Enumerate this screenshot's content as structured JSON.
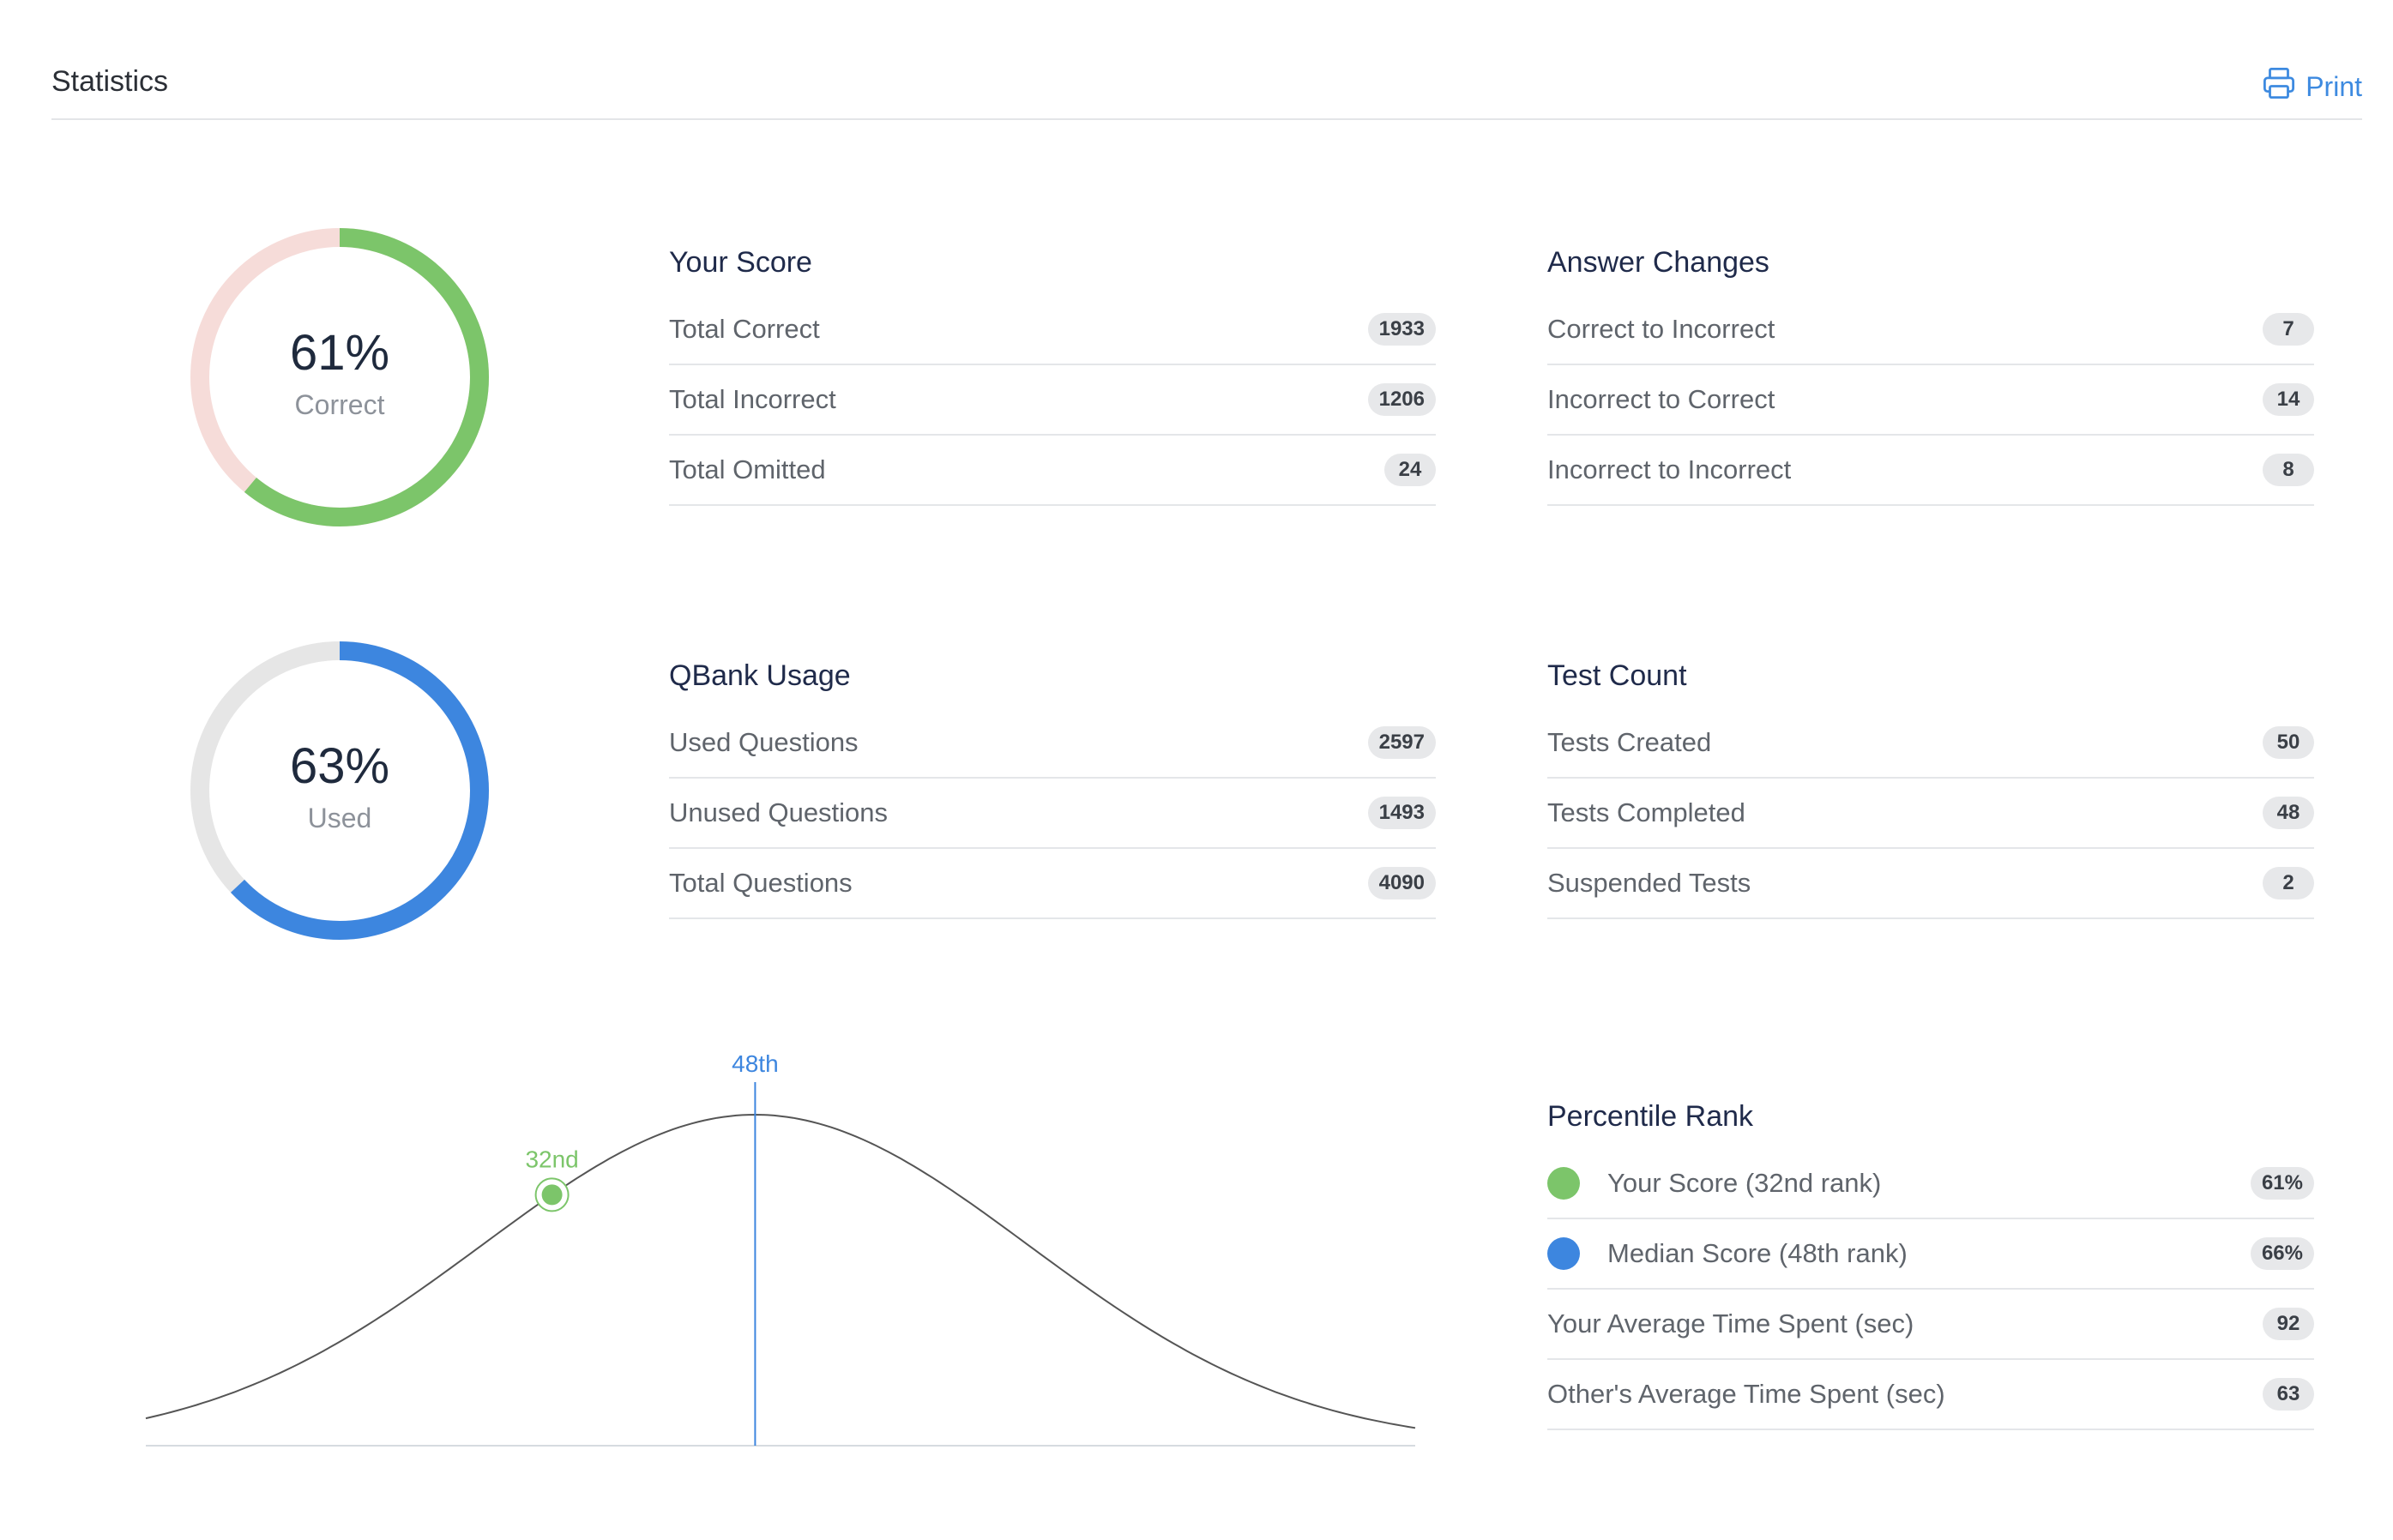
{
  "header": {
    "title": "Statistics",
    "print_label": "Print"
  },
  "donuts": [
    {
      "percent": "61%",
      "label": "Correct",
      "value": 0.61,
      "color": "#7cc56a",
      "track": "#f6dcd9"
    },
    {
      "percent": "63%",
      "label": "Used",
      "value": 0.63,
      "color": "#3d86df",
      "track": "#e6e6e6"
    }
  ],
  "your_score": {
    "title": "Your Score",
    "rows": [
      {
        "label": "Total Correct",
        "value": "1933"
      },
      {
        "label": "Total Incorrect",
        "value": "1206"
      },
      {
        "label": "Total Omitted",
        "value": "24"
      }
    ]
  },
  "answer_changes": {
    "title": "Answer Changes",
    "rows": [
      {
        "label": "Correct to Incorrect",
        "value": "7"
      },
      {
        "label": "Incorrect to Correct",
        "value": "14"
      },
      {
        "label": "Incorrect to Incorrect",
        "value": "8"
      }
    ]
  },
  "qbank_usage": {
    "title": "QBank Usage",
    "rows": [
      {
        "label": "Used Questions",
        "value": "2597"
      },
      {
        "label": "Unused Questions",
        "value": "1493"
      },
      {
        "label": "Total Questions",
        "value": "4090"
      }
    ]
  },
  "test_count": {
    "title": "Test Count",
    "rows": [
      {
        "label": "Tests Created",
        "value": "50"
      },
      {
        "label": "Tests Completed",
        "value": "48"
      },
      {
        "label": "Suspended Tests",
        "value": "2"
      }
    ]
  },
  "percentile_rank": {
    "title": "Percentile Rank",
    "rows": [
      {
        "label": "Your Score (32nd rank)",
        "value": "61%",
        "dot_color": "#7cc56a"
      },
      {
        "label": "Median Score (48th rank)",
        "value": "66%",
        "dot_color": "#3d86df"
      },
      {
        "label": "Your Average Time Spent (sec)",
        "value": "92"
      },
      {
        "label": "Other's Average Time Spent (sec)",
        "value": "63"
      }
    ]
  },
  "chart_data": {
    "type": "line",
    "title": "",
    "markers": [
      {
        "label": "32nd",
        "percentile": 32,
        "color": "#7cc56a"
      },
      {
        "label": "48th",
        "percentile": 48,
        "color": "#3d86df"
      }
    ]
  }
}
